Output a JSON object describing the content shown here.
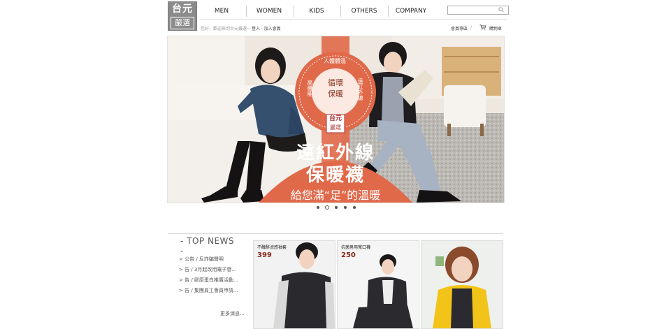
{
  "brand": {
    "logo_line1": "台元",
    "logo_line2": "嚴選"
  },
  "nav": {
    "items": [
      "MEN",
      "WOMEN",
      "KIDS",
      "OTHERS",
      "COMPANY"
    ]
  },
  "search": {
    "placeholder": ""
  },
  "greeting": {
    "text": "您好，歡迎來到台元嚴選~",
    "login": "登入 · 加入會員"
  },
  "utility": {
    "member": "會員專區",
    "cart": "購物車"
  },
  "banner": {
    "badge_top": "人體體溫",
    "badge_right": "遠紅外線",
    "badge_left": "高機能",
    "badge_bottom": "溫暖",
    "badge_center1": "循環",
    "badge_center2": "保暖",
    "logo_line1": "台元",
    "logo_line2": "嚴選",
    "title1": "遠紅外線",
    "title2": "保暖襪",
    "subtitle": "給您滿“足”的溫暖",
    "colors": {
      "accent": "#e0694a"
    }
  },
  "carousel": {
    "count": 5,
    "active_index": 1
  },
  "top_news": {
    "title": "- TOP NEWS -",
    "items": [
      "> 公告 / 反詐騙聲明",
      "> 告 / 3月起改用電子發...",
      "> 告 / 膠原蛋白推廣活動...",
      "> 告 / 集團員工會員申請..."
    ],
    "more": "更多消息..."
  },
  "products": [
    {
      "label": "不醜酢涼感袖套",
      "price": "399"
    },
    {
      "label": "抗菌男用寬口襪",
      "price": "250"
    },
    {
      "label": "",
      "price": ""
    }
  ]
}
